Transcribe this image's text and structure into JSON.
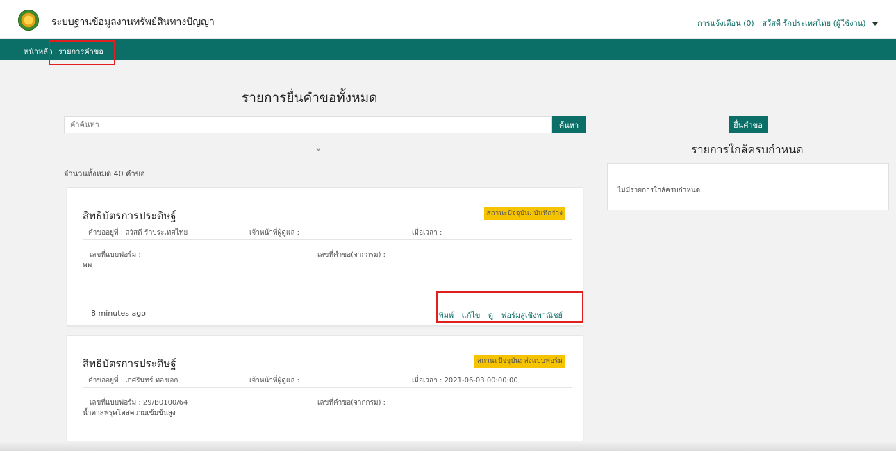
{
  "app": {
    "title": "ระบบฐานข้อมูลงานทรัพย์สินทางปัญญา",
    "notifications": "การแจ้งเตือน (0)",
    "user": "สวัสดี รักประเทศไทย (ผู้ใช้งาน)"
  },
  "nav": {
    "home": "หน้าหลัก",
    "requests": "รายการคำขอ"
  },
  "main": {
    "title": "รายการยื่นคำขอทั้งหมด",
    "search_placeholder": "คำค้นหา",
    "search_button": "ค้นหา",
    "expand_icon": "⌄",
    "total": "จำนวนทั้งหมด 40 คำขอ"
  },
  "cards": [
    {
      "title": "สิทธิบัตรการประดิษฐ์",
      "status": "สถานะปัจจุบัน: บันทึกร่าง",
      "owner": "คำขออยู่ที่ : สวัสดี รักประเทศไทย",
      "officer": "เจ้าหน้าที่ผู้ดูแล :",
      "datetime": "เมื่อเวลา :",
      "form_no": "เลขที่แบบฟอร์ม :",
      "request_no": "เลขที่คำขอ(จากกรม) :",
      "subtitle": "พพ",
      "time": "8 minutes ago",
      "actions": [
        "พิมพ์",
        "แก้ไข",
        "ดู",
        "ฟอร์มสู่เชิงพาณิชย์"
      ]
    },
    {
      "title": "สิทธิบัตรการประดิษฐ์",
      "status": "สถานะปัจจุบัน: ส่งแบบฟอร์ม",
      "owner": "คำขออยู่ที่ : เกศรินทร์ ทองเอก",
      "officer": "เจ้าหน้าที่ผู้ดูแล :",
      "datetime": "เมื่อเวลา : 2021-06-03 00:00:00",
      "form_no": "เลขที่แบบฟอร์ม : 29/B0100/64",
      "request_no": "เลขที่คำขอ(จากกรม) :",
      "subtitle": "น้ำตาลฟรุคโตสความเข้มข้นสูง"
    }
  ],
  "sidebar": {
    "submit_button": "ยื่นคำขอ",
    "due_title": "รายการใกล้ครบกำหนด",
    "due_empty": "ไม่มีรายการใกล้ครบกำหนด"
  },
  "colors": {
    "primary": "#0b6e67",
    "badge": "#f6c300",
    "highlight": "#e02020"
  }
}
